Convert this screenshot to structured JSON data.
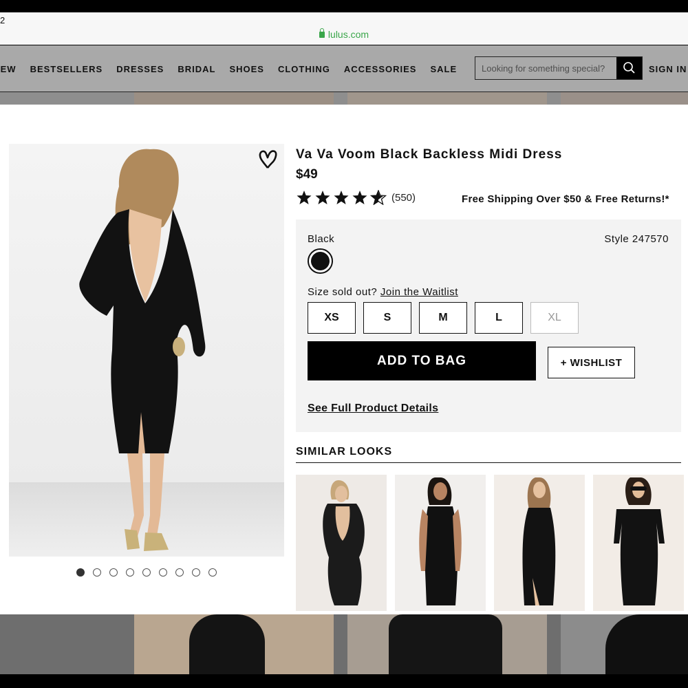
{
  "status_bar": {
    "clock_fragment": "2"
  },
  "browser": {
    "url": "lulus.com"
  },
  "nav": {
    "items": [
      "IEW",
      "BESTSELLERS",
      "DRESSES",
      "BRIDAL",
      "SHOES",
      "CLOTHING",
      "ACCESSORIES",
      "SALE"
    ],
    "search_placeholder": "Looking for something special?",
    "sign_in": "SIGN IN"
  },
  "product": {
    "title": "Va Va Voom Black Backless Midi Dress",
    "price": "$49",
    "rating": 4.5,
    "review_count": "(550)",
    "shipping_note": "Free Shipping Over $50 & Free Returns!*",
    "color_label": "Black",
    "style_number": "Style 247570",
    "sold_out_text": "Size sold out?",
    "waitlist_link": "Join the Waitlist",
    "sizes": [
      {
        "label": "XS",
        "available": true
      },
      {
        "label": "S",
        "available": true
      },
      {
        "label": "M",
        "available": true
      },
      {
        "label": "L",
        "available": true
      },
      {
        "label": "XL",
        "available": false
      }
    ],
    "add_to_bag": "ADD TO BAG",
    "wishlist": "+ WISHLIST",
    "details_link": "See Full Product Details",
    "image_count": 9,
    "active_image": 1
  },
  "similar": {
    "heading": "SIMILAR LOOKS",
    "items": [
      "black-lace-backless-dress",
      "black-sleeveless-bodycon-dress",
      "black-long-sleeve-midi-dress",
      "black-off-shoulder-midi-dress"
    ]
  },
  "colors": {
    "accent": "#000000",
    "secure_green": "#3aa64a",
    "panel_bg": "#f3f3f3"
  }
}
